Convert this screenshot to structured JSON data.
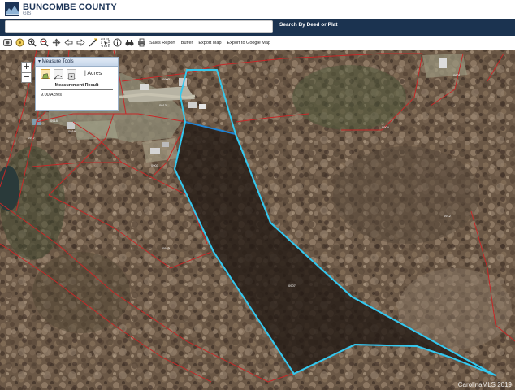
{
  "header": {
    "title": "BUNCOMBE COUNTY",
    "subtitle": "GIS"
  },
  "search": {
    "value": "",
    "placeholder": "",
    "button_label": "Search By Deed or Plat"
  },
  "toolbar": {
    "icons": [
      "full-extent-icon",
      "identify-icon",
      "zoom-in-icon",
      "zoom-out-icon",
      "pan-icon",
      "previous-extent-icon",
      "next-extent-icon",
      "measure-icon",
      "select-icon",
      "info-icon",
      "binoculars-icon",
      "print-icon"
    ],
    "sales_report": "Sales Report",
    "buffer": "Buffer",
    "export_map": "Export Map",
    "export_google": "Export to Google Map"
  },
  "map": {
    "zoom_in_label": "+",
    "zoom_out_label": "−",
    "parcel_labels": [
      "0900",
      "0913",
      "0918",
      "0919",
      "0917",
      "0903",
      "0910",
      "0912",
      "0907",
      "0901",
      "0904",
      "0930"
    ],
    "watermark": "CarolinaMLS 2019",
    "colors": {
      "parcel_lines": "#c62828",
      "selected_outline": "#35c8ec",
      "measured_outline": "#1f83d4"
    }
  },
  "measure": {
    "header": "Measure Tools",
    "unit": "Acres",
    "result_title": "Measurement Result",
    "result_value": "9.00 Acres"
  }
}
